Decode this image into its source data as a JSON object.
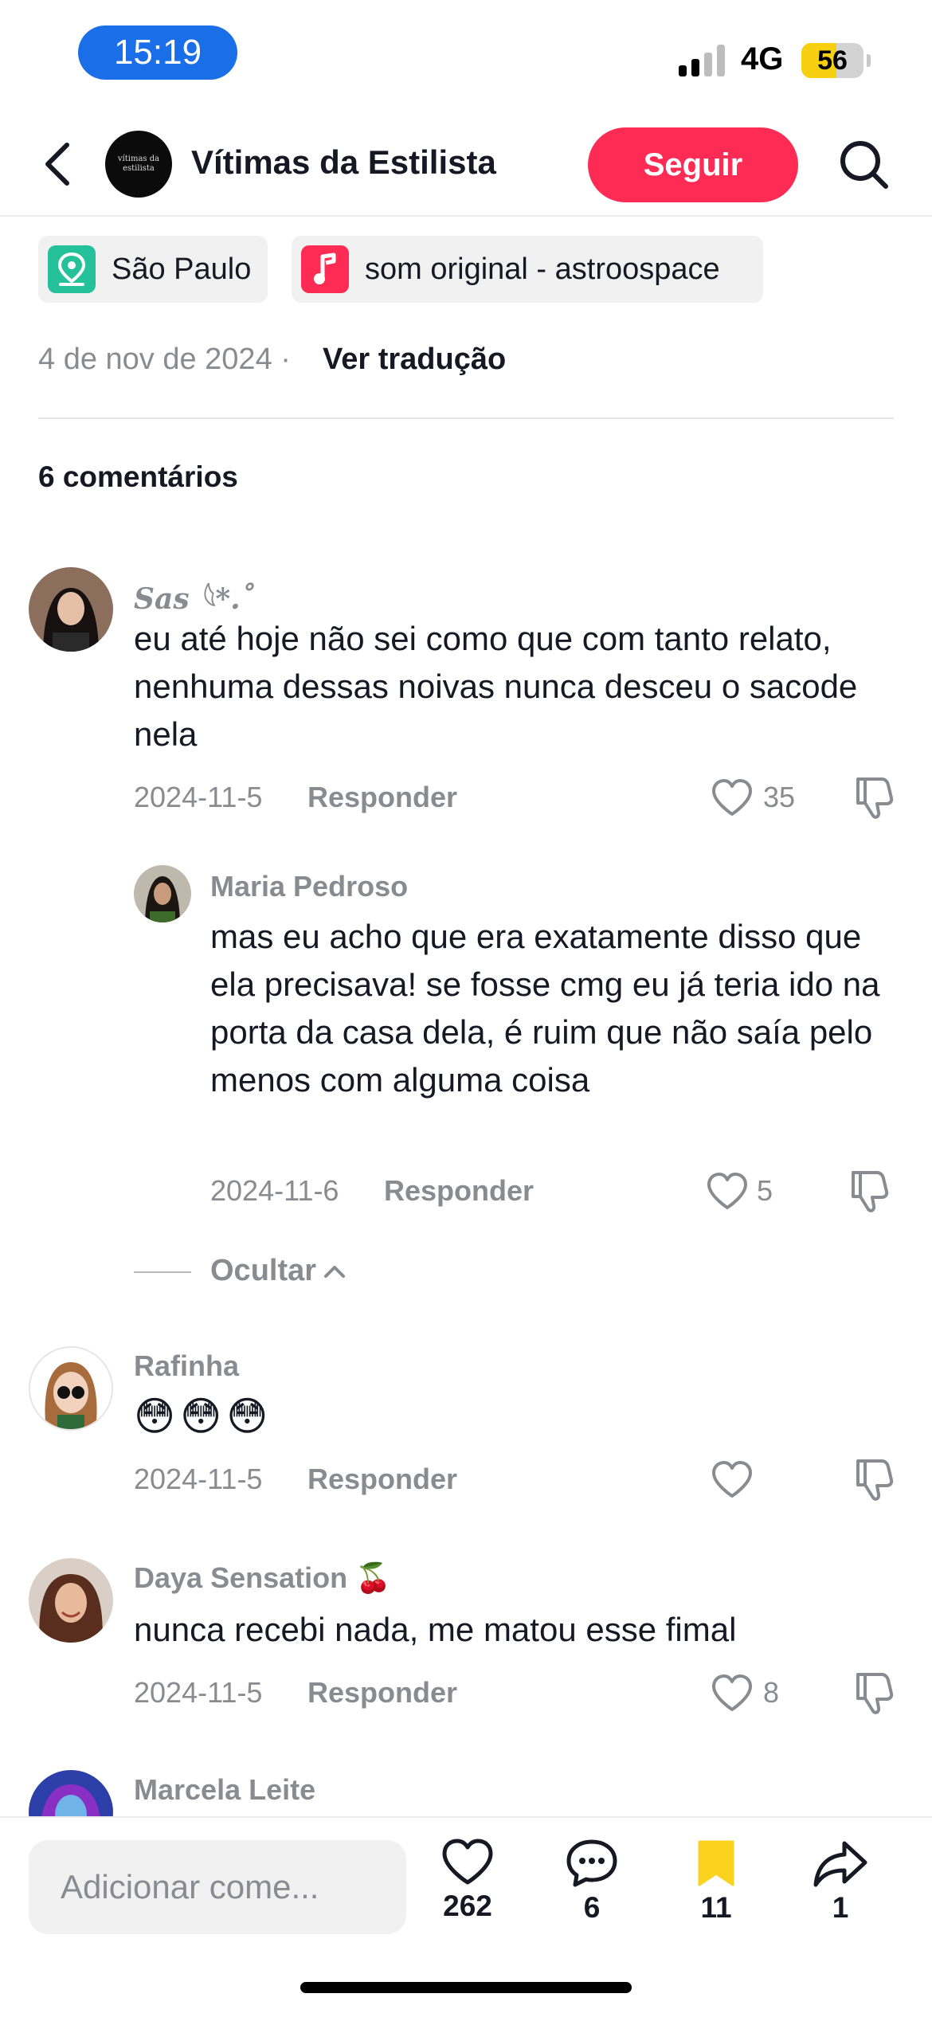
{
  "status_bar": {
    "time": "15:19",
    "network": "4G",
    "battery": "56",
    "battery_level": 0.56
  },
  "header": {
    "title": "Vítimas da Estilista",
    "avatar_text": "vítimas da estilista",
    "follow_label": "Seguir"
  },
  "chips": {
    "location": "São Paulo",
    "sound": "som original - astroospace"
  },
  "post_meta": {
    "date": "4 de nov de 2024 · ",
    "translate": "Ver tradução"
  },
  "comments_count": "6 comentários",
  "comments": [
    {
      "name": "Sas 𓆩*.˚",
      "text": "eu até hoje não sei como que com tanto relato, nenhuma dessas noivas nunca desceu o sacode nela",
      "date": "2024-11-5",
      "reply": "Responder",
      "likes": "35"
    },
    {
      "name": "Maria Pedroso",
      "text": "mas eu acho que era exatamente disso que ela precisava! se fosse cmg eu já teria ido na porta da casa dela, é ruim que não saía pelo menos com alguma coisa",
      "date": "2024-11-6",
      "reply": "Responder",
      "likes": "5"
    },
    {
      "name": "Rafinha",
      "text": "😳😳😳",
      "date": "2024-11-5",
      "reply": "Responder",
      "likes": ""
    },
    {
      "name": "Daya Sensation 🍒",
      "text": "nunca recebi nada, me matou esse fimal",
      "date": "2024-11-5",
      "reply": "Responder",
      "likes": "8"
    },
    {
      "name": "Marcela Leite"
    }
  ],
  "hide_replies": "Ocultar",
  "bottom_bar": {
    "placeholder": "Adicionar come...",
    "likes": "262",
    "comments": "6",
    "saves": "11",
    "shares": "1"
  },
  "colors": {
    "accent": "#fe2c55",
    "save_yellow": "#fbd21e",
    "time_pill": "#1a6fe8",
    "location_green": "#25c19a"
  }
}
